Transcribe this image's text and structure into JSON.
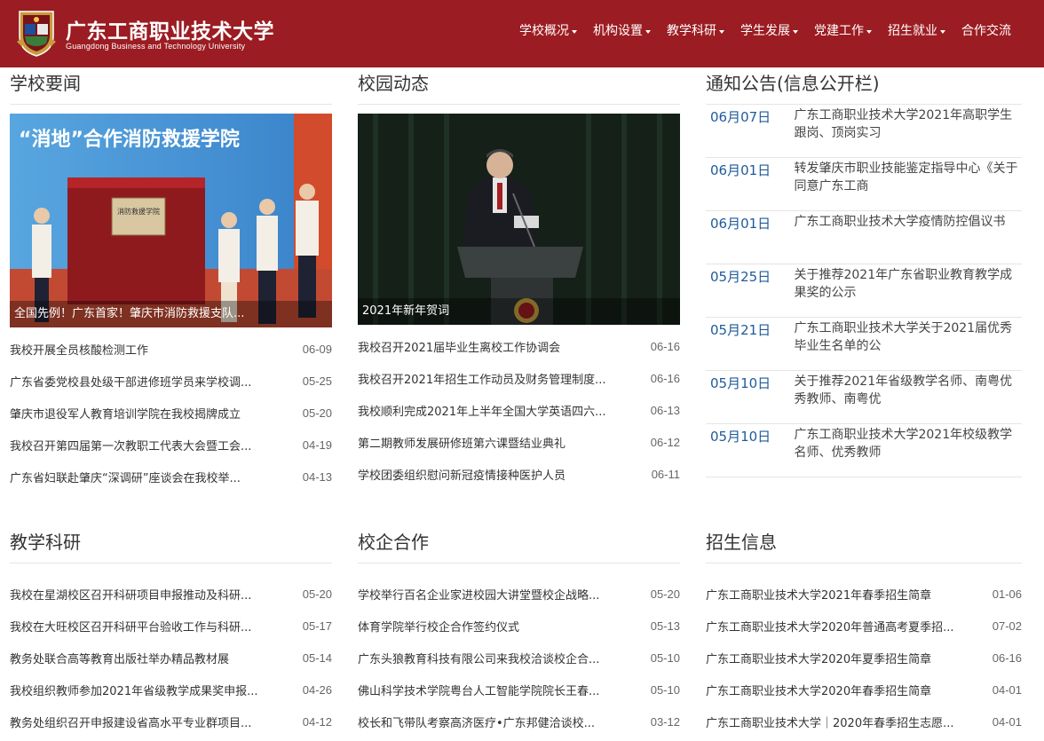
{
  "header": {
    "logo_cn": "广东工商职业技术大学",
    "logo_en": "Guangdong Business and Technology University",
    "nav": [
      {
        "label": "学校概况",
        "dropdown": true
      },
      {
        "label": "机构设置",
        "dropdown": true
      },
      {
        "label": "教学科研",
        "dropdown": true
      },
      {
        "label": "学生发展",
        "dropdown": true
      },
      {
        "label": "党建工作",
        "dropdown": true
      },
      {
        "label": "招生就业",
        "dropdown": true
      },
      {
        "label": "合作交流",
        "dropdown": false
      }
    ]
  },
  "school_news": {
    "title": "学校要闻",
    "photo_caption": "全国先例！广东首家！肇庆市消防救援支队...",
    "photo_banner": "“消地”合作消防救援学院",
    "photo_plaque": "消防救援学院",
    "items": [
      {
        "title": "我校开展全员核酸检测工作",
        "date": "06-09"
      },
      {
        "title": "广东省委党校县处级干部进修班学员来学校调...",
        "date": "05-25"
      },
      {
        "title": "肇庆市退役军人教育培训学院在我校揭牌成立",
        "date": "05-20"
      },
      {
        "title": "我校召开第四届第一次教职工代表大会暨工会...",
        "date": "04-19"
      },
      {
        "title": "广东省妇联赴肇庆“深调研”座谈会在我校举...",
        "date": "04-13"
      }
    ]
  },
  "campus_news": {
    "title": "校园动态",
    "photo_caption": "2021年新年贺词",
    "items": [
      {
        "title": "我校召开2021届毕业生离校工作协调会",
        "date": "06-16"
      },
      {
        "title": "我校召开2021年招生工作动员及财务管理制度...",
        "date": "06-16"
      },
      {
        "title": "我校顺利完成2021年上半年全国大学英语四六...",
        "date": "06-13"
      },
      {
        "title": "第二期教师发展研修班第六课暨结业典礼",
        "date": "06-12"
      },
      {
        "title": "学校团委组织慰问新冠疫情接种医护人员",
        "date": "06-11"
      }
    ]
  },
  "notices": {
    "title": "通知公告(信息公开栏)",
    "items": [
      {
        "date": "06月07日",
        "title": "广东工商职业技术大学2021年高职学生跟岗、顶岗实习"
      },
      {
        "date": "06月01日",
        "title": "转发肇庆市职业技能鉴定指导中心《关于同意广东工商"
      },
      {
        "date": "06月01日",
        "title": "广东工商职业技术大学疫情防控倡议书"
      },
      {
        "date": "05月25日",
        "title": "关于推荐2021年广东省职业教育教学成果奖的公示"
      },
      {
        "date": "05月21日",
        "title": "广东工商职业技术大学关于2021届优秀毕业生名单的公"
      },
      {
        "date": "05月10日",
        "title": "关于推荐2021年省级教学名师、南粤优秀教师、南粤优"
      },
      {
        "date": "05月10日",
        "title": "广东工商职业技术大学2021年校级教学名师、优秀教师"
      }
    ]
  },
  "research": {
    "title": "教学科研",
    "items": [
      {
        "title": "我校在星湖校区召开科研项目申报推动及科研...",
        "date": "05-20"
      },
      {
        "title": "我校在大旺校区召开科研平台验收工作与科研...",
        "date": "05-17"
      },
      {
        "title": "教务处联合高等教育出版社举办精品教材展",
        "date": "05-14"
      },
      {
        "title": "我校组织教师参加2021年省级教学成果奖申报...",
        "date": "04-26"
      },
      {
        "title": "教务处组织召开申报建设省高水平专业群项目...",
        "date": "04-12"
      }
    ]
  },
  "cooperation": {
    "title": "校企合作",
    "items": [
      {
        "title": "学校举行百名企业家进校园大讲堂暨校企战略...",
        "date": "05-20"
      },
      {
        "title": "体育学院举行校企合作签约仪式",
        "date": "05-13"
      },
      {
        "title": "广东头狼教育科技有限公司来我校洽谈校企合...",
        "date": "05-10"
      },
      {
        "title": "佛山科学技术学院粤台人工智能学院院长王春...",
        "date": "05-10"
      },
      {
        "title": "校长和飞带队考察高济医疗•广东邦健洽谈校...",
        "date": "03-12"
      }
    ]
  },
  "admissions": {
    "title": "招生信息",
    "items": [
      {
        "title": "广东工商职业技术大学2021年春季招生简章",
        "date": "01-06"
      },
      {
        "title": "广东工商职业技术大学2020年普通高考夏季招...",
        "date": "07-02"
      },
      {
        "title": "广东工商职业技术大学2020年夏季招生简章",
        "date": "06-16"
      },
      {
        "title": "广东工商职业技术大学2020年春季招生简章",
        "date": "04-01"
      },
      {
        "title": "广东工商职业技术大学｜2020年春季招生志愿...",
        "date": "04-01"
      }
    ]
  },
  "colors": {
    "header_bg": "#9b1c22",
    "notice_date": "#1e5a9a"
  }
}
